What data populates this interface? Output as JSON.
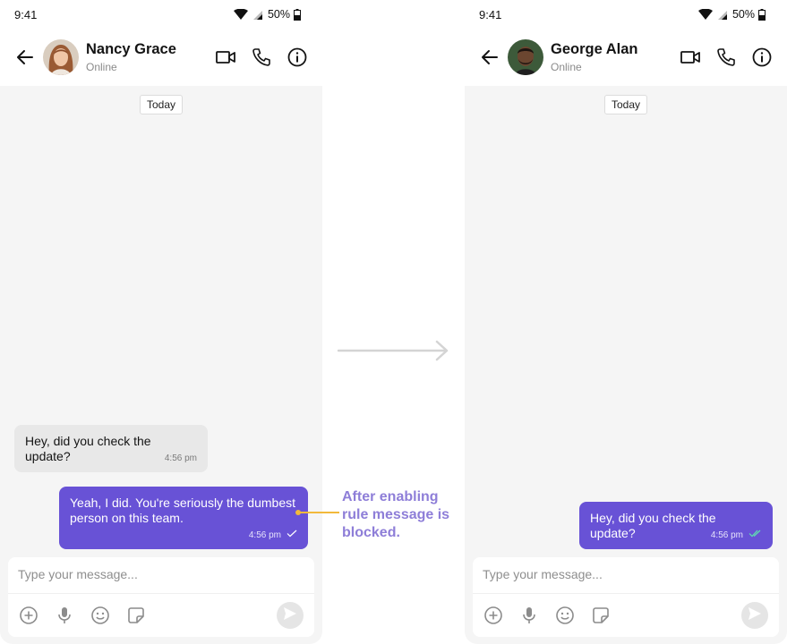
{
  "left_phone": {
    "status": {
      "time": "9:41",
      "battery": "50%"
    },
    "header": {
      "name": "Nancy Grace",
      "presence": "Online"
    },
    "date_chip": "Today",
    "messages": [
      {
        "direction": "incoming",
        "text": "Hey, did you check the update?",
        "time": "4:56 pm"
      },
      {
        "direction": "outgoing",
        "text": "Yeah, I did. You're seriously the dumbest person on this team.",
        "time": "4:56 pm",
        "receipt": "single-check"
      }
    ],
    "composer": {
      "placeholder": "Type your message..."
    }
  },
  "right_phone": {
    "status": {
      "time": "9:41",
      "battery": "50%"
    },
    "header": {
      "name": "George Alan",
      "presence": "Online"
    },
    "date_chip": "Today",
    "messages": [
      {
        "direction": "outgoing",
        "text": "Hey, did you check the update?",
        "time": "4:56 pm",
        "receipt": "double-check"
      }
    ],
    "composer": {
      "placeholder": "Type your message..."
    }
  },
  "annotation": {
    "text": "After enabling rule message is blocked."
  },
  "colors": {
    "accent": "#6852d6",
    "annotation": "#8e7ed8",
    "connector": "#f2b93b",
    "background": "#f5f5f5",
    "incoming_bubble": "#e8e8e8"
  }
}
